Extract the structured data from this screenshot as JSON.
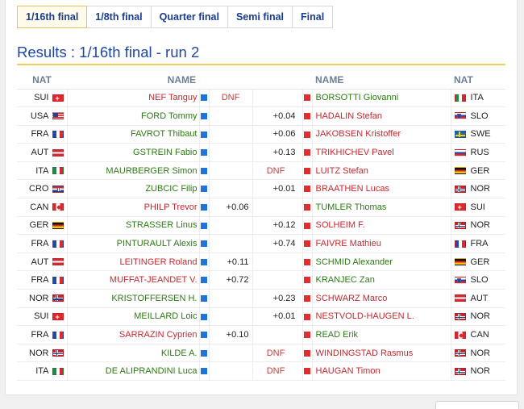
{
  "tabs": [
    {
      "label": "1/16th final",
      "active": true
    },
    {
      "label": "1/8th final",
      "active": false
    },
    {
      "label": "Quarter final",
      "active": false
    },
    {
      "label": "Semi final",
      "active": false
    },
    {
      "label": "Final",
      "active": false
    }
  ],
  "title": "Results : 1/16th final - run 2",
  "headers": {
    "nat_left": "NAT",
    "name_left": "NAME",
    "name_right": "NAME",
    "nat_right": "NAT"
  },
  "colors": {
    "winner": "#2c7a13",
    "loser": "#c8282e",
    "blue_course": "#1e74d9",
    "red_course": "#e02d2d"
  },
  "rows": [
    {
      "lnat": "SUI",
      "lflag": "sui",
      "lname": "NEF Tanguy",
      "lres": "loser",
      "lgap": "DNF",
      "rgap": "",
      "rname": "BORSOTTI Giovanni",
      "rres": "winner",
      "rflag": "ita",
      "rnat": "ITA"
    },
    {
      "lnat": "USA",
      "lflag": "usa",
      "lname": "FORD Tommy",
      "lres": "winner",
      "lgap": "",
      "rgap": "+0.04",
      "rname": "HADALIN Stefan",
      "rres": "loser",
      "rflag": "slo",
      "rnat": "SLO"
    },
    {
      "lnat": "FRA",
      "lflag": "fra",
      "lname": "FAVROT Thibaut",
      "lres": "winner",
      "lgap": "",
      "rgap": "+0.06",
      "rname": "JAKOBSEN Kristoffer",
      "rres": "loser",
      "rflag": "swe",
      "rnat": "SWE"
    },
    {
      "lnat": "AUT",
      "lflag": "aut",
      "lname": "GSTREIN Fabio",
      "lres": "winner",
      "lgap": "",
      "rgap": "+0.13",
      "rname": "TRIKHICHEV Pavel",
      "rres": "loser",
      "rflag": "rus",
      "rnat": "RUS"
    },
    {
      "lnat": "ITA",
      "lflag": "ita",
      "lname": "MAURBERGER Simon",
      "lres": "winner",
      "lgap": "",
      "rgap": "DNF",
      "rname": "LUITZ Stefan",
      "rres": "loser",
      "rflag": "ger",
      "rnat": "GER"
    },
    {
      "lnat": "CRO",
      "lflag": "cro",
      "lname": "ZUBCIC Filip",
      "lres": "winner",
      "lgap": "",
      "rgap": "+0.01",
      "rname": "BRAATHEN Lucas",
      "rres": "loser",
      "rflag": "nor",
      "rnat": "NOR"
    },
    {
      "lnat": "CAN",
      "lflag": "can",
      "lname": "PHILP Trevor",
      "lres": "loser",
      "lgap": "+0.06",
      "rgap": "",
      "rname": "TUMLER Thomas",
      "rres": "winner",
      "rflag": "sui",
      "rnat": "SUI"
    },
    {
      "lnat": "GER",
      "lflag": "ger",
      "lname": "STRASSER Linus",
      "lres": "winner",
      "lgap": "",
      "rgap": "+0.12",
      "rname": "SOLHEIM F.",
      "rres": "loser",
      "rflag": "nor",
      "rnat": "NOR"
    },
    {
      "lnat": "FRA",
      "lflag": "fra",
      "lname": "PINTURAULT Alexis",
      "lres": "winner",
      "lgap": "",
      "rgap": "+0.74",
      "rname": "FAIVRE Mathieu",
      "rres": "loser",
      "rflag": "fra",
      "rnat": "FRA"
    },
    {
      "lnat": "AUT",
      "lflag": "aut",
      "lname": "LEITINGER Roland",
      "lres": "loser",
      "lgap": "+0.11",
      "rgap": "",
      "rname": "SCHMID Alexander",
      "rres": "winner",
      "rflag": "ger",
      "rnat": "GER"
    },
    {
      "lnat": "FRA",
      "lflag": "fra",
      "lname": "MUFFAT-JEANDET V.",
      "lres": "loser",
      "lgap": "+0.72",
      "rgap": "",
      "rname": "KRANJEC Zan",
      "rres": "winner",
      "rflag": "slo",
      "rnat": "SLO"
    },
    {
      "lnat": "NOR",
      "lflag": "nor",
      "lname": "KRISTOFFERSEN H.",
      "lres": "winner",
      "lgap": "",
      "rgap": "+0.23",
      "rname": "SCHWARZ Marco",
      "rres": "loser",
      "rflag": "aut",
      "rnat": "AUT"
    },
    {
      "lnat": "SUI",
      "lflag": "sui",
      "lname": "MEILLARD Loic",
      "lres": "winner",
      "lgap": "",
      "rgap": "+0.01",
      "rname": "NESTVOLD-HAUGEN L.",
      "rres": "loser",
      "rflag": "nor",
      "rnat": "NOR"
    },
    {
      "lnat": "FRA",
      "lflag": "fra",
      "lname": "SARRAZIN Cyprien",
      "lres": "loser",
      "lgap": "+0.10",
      "rgap": "",
      "rname": "READ Erik",
      "rres": "winner",
      "rflag": "can",
      "rnat": "CAN"
    },
    {
      "lnat": "NOR",
      "lflag": "nor",
      "lname": "KILDE A.",
      "lres": "winner",
      "lgap": "",
      "rgap": "DNF",
      "rname": "WINDINGSTAD Rasmus",
      "rres": "loser",
      "rflag": "nor",
      "rnat": "NOR"
    },
    {
      "lnat": "ITA",
      "lflag": "ita",
      "lname": "DE ALIPRANDINI Luca",
      "lres": "winner",
      "lgap": "",
      "rgap": "DNF",
      "rname": "HAUGAN Timon",
      "rres": "loser",
      "rflag": "nor",
      "rnat": "NOR"
    }
  ]
}
